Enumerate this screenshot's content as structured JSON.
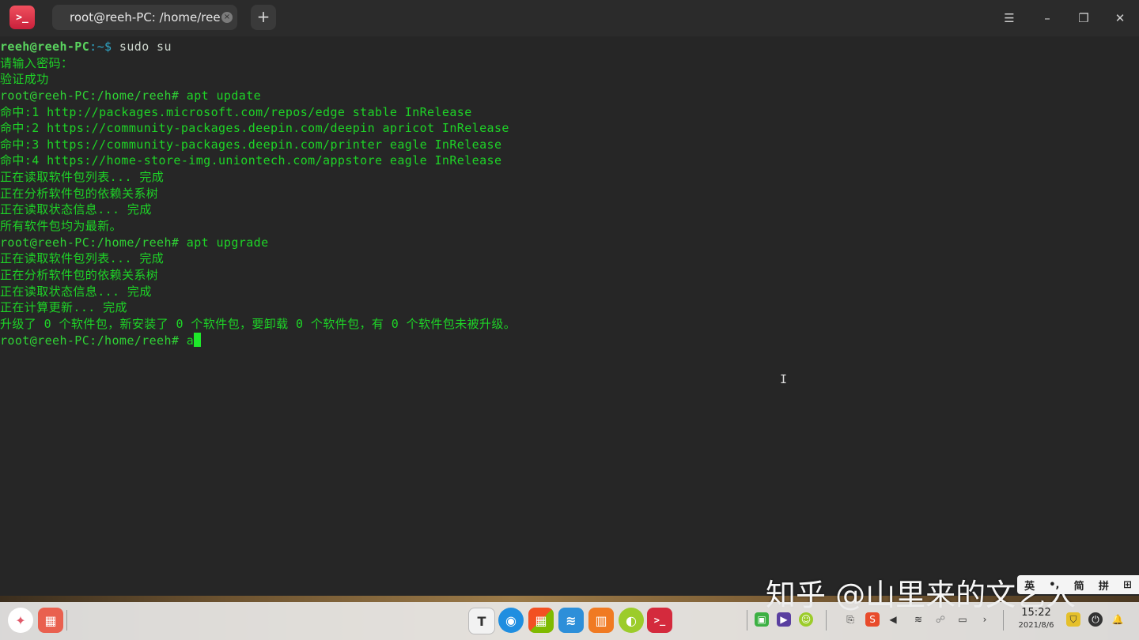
{
  "window": {
    "tab_title": "root@reeh-PC: /home/reeh",
    "tab_close_glyph": "×",
    "add_tab_glyph": "+",
    "menu_glyph": "☰",
    "minimize_glyph": "–",
    "maximize_glyph": "❐",
    "close_glyph": "✕",
    "app_icon_glyph": ">_"
  },
  "terminal": {
    "prompt1_user": "reeh@reeh-PC",
    "prompt1_path": ":~$",
    "prompt1_cmd": " sudo su",
    "line_password": "请输入密码：",
    "line_verified": "验证成功",
    "prompt2": "root@reeh-PC:/home/reeh#",
    "prompt2_cmd": " apt update",
    "hit1": "命中:1 http://packages.microsoft.com/repos/edge stable InRelease",
    "hit2": "命中:2 https://community-packages.deepin.com/deepin apricot InRelease",
    "hit3": "命中:3 https://community-packages.deepin.com/printer eagle InRelease",
    "hit4": "命中:4 https://home-store-img.uniontech.com/appstore eagle InRelease",
    "reading_list": "正在读取软件包列表... 完成",
    "analyzing_tree": "正在分析软件包的依赖关系树",
    "reading_state": "正在读取状态信息... 完成",
    "all_latest": "所有软件包均为最新。",
    "prompt3": "root@reeh-PC:/home/reeh#",
    "prompt3_cmd": " apt upgrade",
    "reading_list2": "正在读取软件包列表... 完成",
    "analyzing_tree2": "正在分析软件包的依赖关系树",
    "reading_state2": "正在读取状态信息... 完成",
    "calculating": "正在计算更新... 完成",
    "summary": "升级了 0 个软件包，新安装了 0 个软件包，要卸载 0 个软件包，有 0 个软件包未被升级。",
    "prompt4": "root@reeh-PC:/home/reeh#",
    "prompt4_input": " a",
    "ibeam_glyph": "I"
  },
  "watermark": "知乎 @山里来的文艺人",
  "ime": {
    "lang": "英",
    "punct": "•,",
    "mode1": "简",
    "mode2": "拼",
    "grid": "⊞"
  },
  "taskbar": {
    "launcher_glyph": "✦",
    "multitask_glyph": "▦",
    "apps": [
      "T",
      "◉",
      "▦",
      "≋",
      "▥",
      "◐",
      ">_"
    ],
    "tray": [
      "▣",
      "▶",
      "☺",
      "⎘",
      "S",
      "◀",
      "≋",
      "☍",
      "▭",
      "›"
    ],
    "time": "15:22",
    "date": "2021/8/6",
    "shield_glyph": "⛉",
    "power_glyph": "⏻",
    "bell_glyph": "🔔"
  },
  "colors": {
    "terminal_text": "#1ed427",
    "terminal_bg": "#262626",
    "app_icon": "#e0364c"
  }
}
